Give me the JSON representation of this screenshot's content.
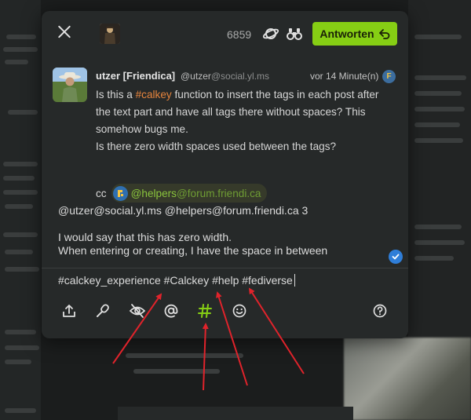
{
  "dialog": {
    "char_count": "6859",
    "reply_button_label": "Antworten",
    "colors": {
      "accent": "#86ce14",
      "hashtag": "#e6843d",
      "mention": "#8ac43d",
      "annotation": "#e0232b"
    }
  },
  "note": {
    "author_name": "utzer [Friendica]",
    "author_handle_user": "@utzer",
    "author_handle_host": "@social.yl.ms",
    "timestamp": "vor 14 Minute(n)",
    "instance_badge": "F",
    "body_prefix": "Is this a ",
    "body_hashtag": "#calkey",
    "body_line1_rest": " function to insert the tags in each post after the text part and have all tags there without spaces? This somehow bugs me.",
    "body_line2": "Is there zero width spaces used between the tags?",
    "cc_label": "cc",
    "cc_mention_user": "@helpers",
    "cc_mention_host": "@forum.friendi.ca"
  },
  "draft": {
    "line1": "@utzer@social.yl.ms @helpers@forum.friendi.ca 3",
    "line2": "I would say that this has zero width.",
    "line3": "When entering or creating, I have the space in between"
  },
  "hashtags_field": {
    "value": "#calckey_experience #Calckey #help #fediverse"
  },
  "toolbar": {
    "icons": [
      "upload-icon",
      "poll-icon",
      "content-warning-icon",
      "mention-icon",
      "hashtag-icon",
      "emoji-icon",
      "help-icon"
    ]
  }
}
